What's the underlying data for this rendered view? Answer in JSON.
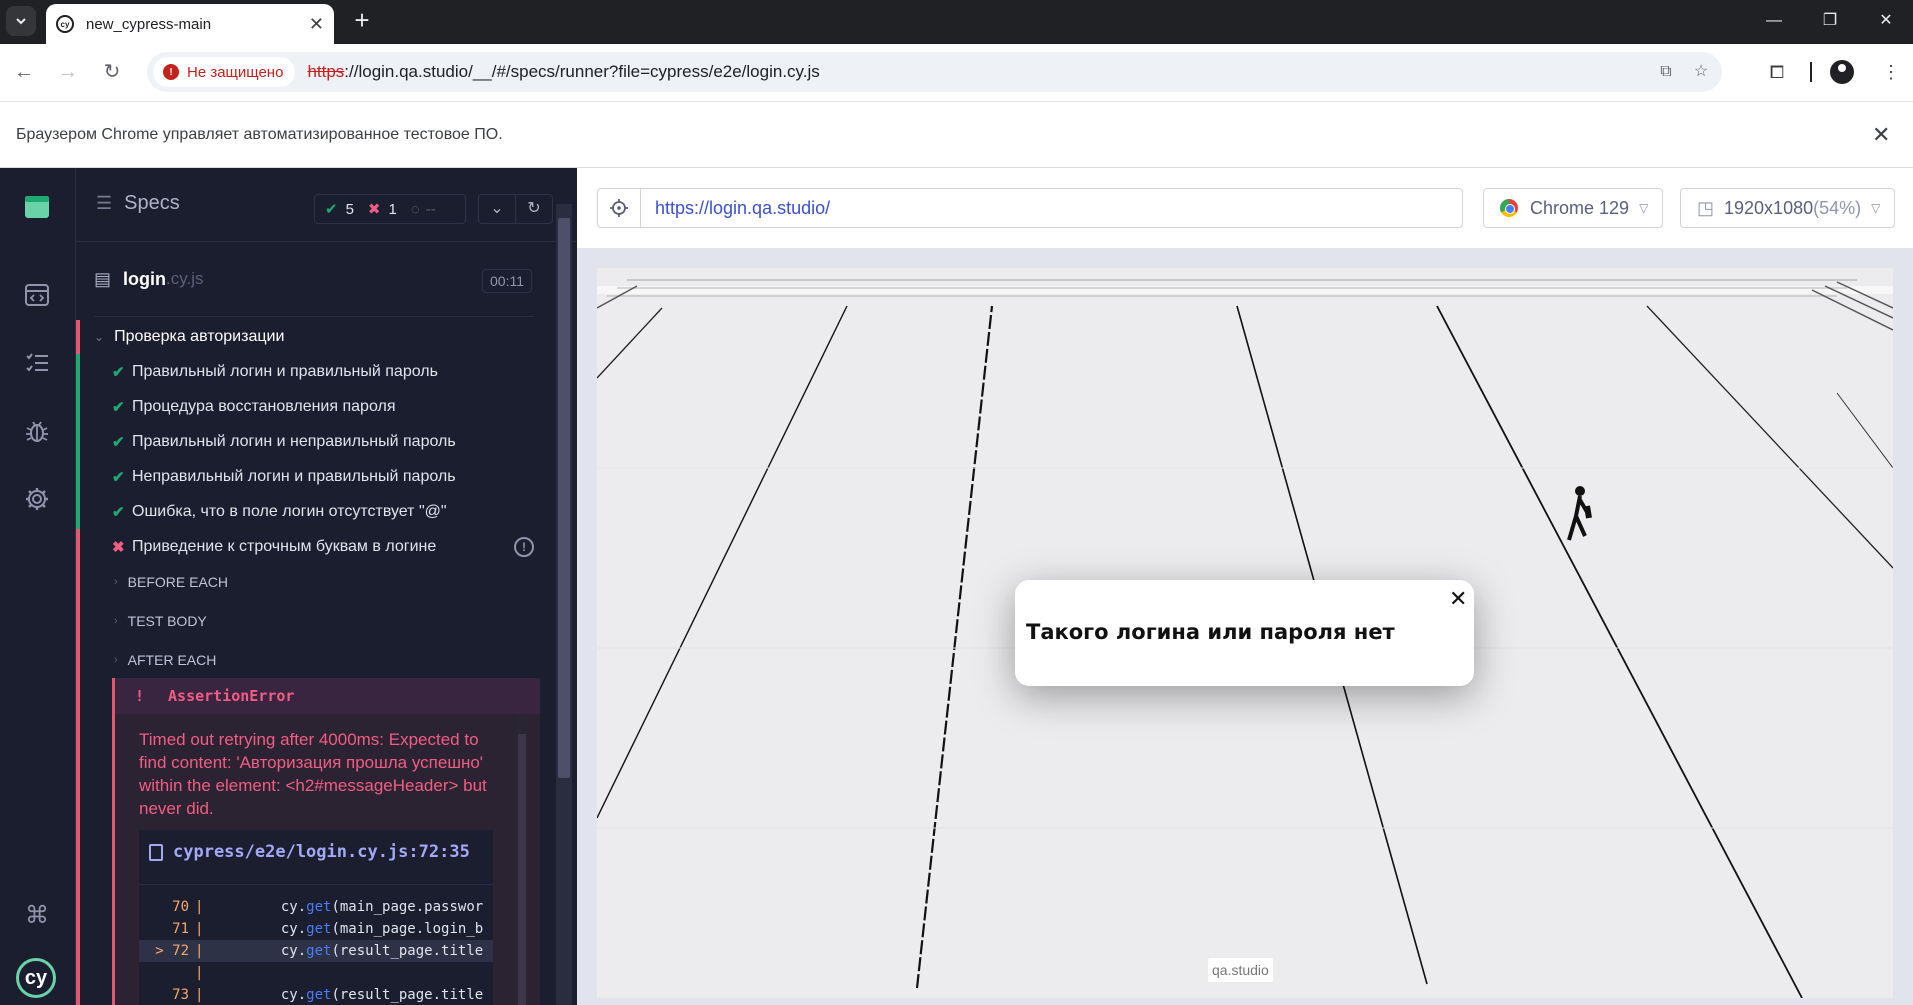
{
  "browser": {
    "tab_title": "new_cypress-main",
    "security_label": "Не защищено",
    "url_proto": "https",
    "url_rest": "://login.qa.studio/__/#/specs/runner?file=cypress/e2e/login.cy.js",
    "infobar_text": "Браузером Chrome управляет автоматизированное тестовое ПО."
  },
  "reporter": {
    "specs_label": "Specs",
    "passed": "5",
    "failed": "1",
    "pending": "--",
    "spec_name": "login",
    "spec_ext": ".cy.js",
    "spec_time": "00:11",
    "suite_title": "Проверка авторизации",
    "tests": [
      {
        "label": "Правильный логин и правильный пароль",
        "state": "passed"
      },
      {
        "label": "Процедура восстановления пароля",
        "state": "passed"
      },
      {
        "label": "Правильный логин и неправильный пароль",
        "state": "passed"
      },
      {
        "label": "Неправильный логин и правильный пароль",
        "state": "passed"
      },
      {
        "label": "Ошибка, что в поле логин отсутствует \"@\"",
        "state": "passed"
      },
      {
        "label": "Приведение к строчным буквам в логине",
        "state": "failed"
      }
    ],
    "hooks": [
      "BEFORE EACH",
      "TEST BODY",
      "AFTER EACH"
    ],
    "error": {
      "bang": "!",
      "name": "AssertionError",
      "message": "Timed out retrying after 4000ms: Expected to find content: 'Авторизация прошла успешно' within the element: <h2#messageHeader> but never did.",
      "file": "cypress/e2e/login.cy.js:72:35",
      "code": [
        {
          "num": "70",
          "marker": "",
          "text": "        cy.get(main_page.passwor"
        },
        {
          "num": "71",
          "marker": "",
          "text": "        cy.get(main_page.login_b"
        },
        {
          "num": "72",
          "marker": ">",
          "text": "        cy.get(result_page.title"
        },
        {
          "num": "",
          "marker": "",
          "text": ""
        },
        {
          "num": "73",
          "marker": "",
          "text": "        cy.get(result_page.title"
        }
      ]
    }
  },
  "aut": {
    "url": "https://login.qa.studio/",
    "browser_name": "Chrome 129",
    "viewport": "1920x1080",
    "viewport_pct": "(54%)",
    "popup_text": "Такого логина или пароля нет",
    "watermark": "qa.studio"
  },
  "colors": {
    "pass": "#1fa971",
    "fail": "#f15d84",
    "reporter_bg": "#1b1e2e"
  }
}
